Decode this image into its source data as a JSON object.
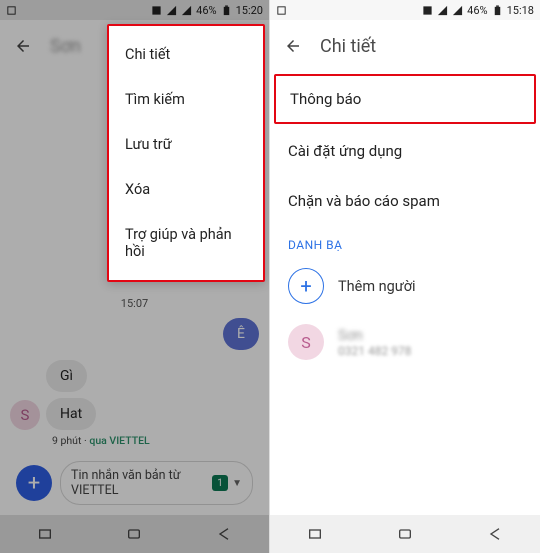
{
  "left": {
    "status": {
      "battery": "46%",
      "time": "15:20"
    },
    "header": {
      "title": "Sơn"
    },
    "menu": {
      "items": [
        "Chi tiết",
        "Tìm kiếm",
        "Lưu trữ",
        "Xóa",
        "Trợ giúp và phản hồi"
      ]
    },
    "conversation": {
      "timestamp": "15:07",
      "out_msg": "Ê",
      "in_msg1": "Gì",
      "in_msg2": "Hat",
      "meta_time": "9 phút",
      "meta_via": "qua VIETTEL",
      "avatar_letter": "S"
    },
    "composer": {
      "placeholder": "Tin nhắn văn bản từ VIETTEL",
      "sim": "1"
    }
  },
  "right": {
    "status": {
      "battery": "46%",
      "time": "15:18"
    },
    "header": {
      "title": "Chi tiết"
    },
    "rows": {
      "notify": "Thông báo",
      "app_settings": "Cài đặt ứng dụng",
      "block": "Chặn và báo cáo spam"
    },
    "contacts": {
      "label": "DANH BẠ",
      "add": "Thêm người",
      "person_letter": "S",
      "person_name": "Sơn",
      "person_sub": "0321 482 978"
    }
  }
}
